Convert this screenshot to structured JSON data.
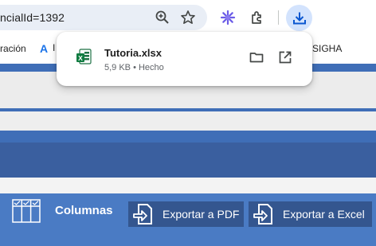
{
  "browser": {
    "url_fragment": "ncialId=1392",
    "icons": {
      "zoom": "zoom-in-icon",
      "bookmark": "star-icon",
      "extension_ai": "perplexity-extension-icon",
      "extensions": "puzzle-icon",
      "downloads": "download-icon"
    }
  },
  "bookmarks": {
    "item1": "ración",
    "item2_initial": "A",
    "item2_partial": "I",
    "item3": "SIGHA"
  },
  "download": {
    "file_name": "Tutoria.xlsx",
    "meta": "5,9 KB • Hecho",
    "file_icon": "excel-file-icon",
    "folder_icon": "folder-icon",
    "open_icon": "open-external-icon"
  },
  "page": {
    "columns_label": "Columnas",
    "export_pdf_label": "Exportar a PDF",
    "export_excel_label": "Exportar a Excel"
  },
  "colors": {
    "accent": "#3f6eb7",
    "dark_bar": "#3a5f9f",
    "button_bg": "#34568f",
    "download_highlight": "#d3e3fd"
  }
}
